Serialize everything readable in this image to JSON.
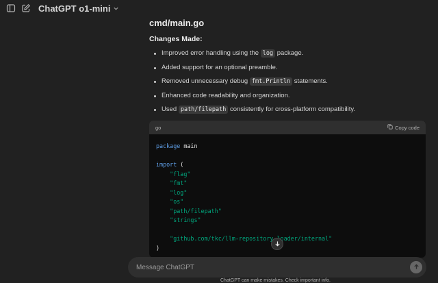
{
  "topbar": {
    "sidebar_toggle_icon": "sidebar-icon",
    "new_chat_icon": "edit-icon",
    "model_name": "ChatGPT o1-mini",
    "model_chevron_icon": "chevron-down-icon"
  },
  "message": {
    "file_title": "cmd/main.go",
    "changes_heading": "Changes Made:",
    "bullets": [
      {
        "before": "Improved error handling using the ",
        "code": "log",
        "after": " package."
      },
      {
        "before": "Added support for an optional preamble.",
        "code": "",
        "after": ""
      },
      {
        "before": "Removed unnecessary debug ",
        "code": "fmt.Println",
        "after": " statements."
      },
      {
        "before": "Enhanced code readability and organization.",
        "code": "",
        "after": ""
      },
      {
        "before": "Used ",
        "code": "path/filepath",
        "after": " consistently for cross-platform compatibility."
      }
    ]
  },
  "code_block": {
    "language": "go",
    "copy_label": "Copy code",
    "lines": [
      {
        "kw": "package",
        "rest": " main"
      },
      {
        "kw": "",
        "rest": ""
      },
      {
        "kw": "import",
        "rest": " ("
      },
      {
        "indent": "    ",
        "str": "\"flag\""
      },
      {
        "indent": "    ",
        "str": "\"fmt\""
      },
      {
        "indent": "    ",
        "str": "\"log\""
      },
      {
        "indent": "    ",
        "str": "\"os\""
      },
      {
        "indent": "    ",
        "str": "\"path/filepath\""
      },
      {
        "indent": "    ",
        "str": "\"strings\""
      },
      {
        "kw": "",
        "rest": ""
      },
      {
        "indent": "    ",
        "str": "\"github.com/tkc/llm-repository-loader/internal\""
      },
      {
        "kw": "",
        "rest": ")"
      }
    ]
  },
  "composer": {
    "placeholder": "Message ChatGPT",
    "send_icon": "arrow-up-icon"
  },
  "footer": {
    "note": "ChatGPT can make mistakes. Check important info."
  }
}
